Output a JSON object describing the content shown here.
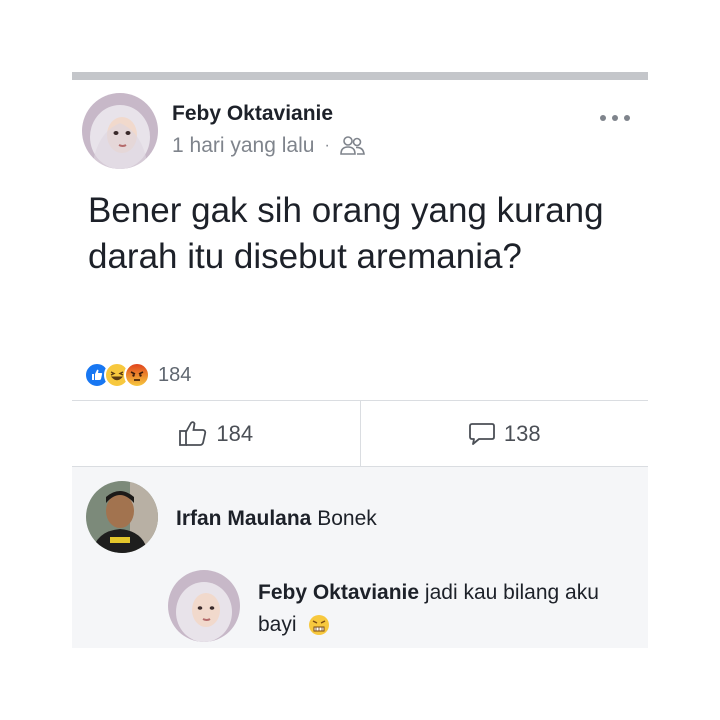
{
  "post": {
    "author": "Feby Oktavianie",
    "time": "1 hari yang lalu",
    "separator": "·",
    "text": "Bener gak sih orang yang kurang darah itu disebut aremania?",
    "reaction_count": "184",
    "reaction_icons": [
      "like-icon",
      "haha-icon",
      "angry-icon"
    ]
  },
  "actions": {
    "like_count": "184",
    "comment_count": "138"
  },
  "comments": [
    {
      "author": "Irfan Maulana",
      "text": "Bonek"
    },
    {
      "author": "Feby Oktavianie",
      "text": "jadi kau bilang aku bayi"
    }
  ],
  "colors": {
    "top_bar": "#c4c6ca",
    "like_blue": "#1877f2",
    "emoji_yellow": "#f7c83e",
    "angry_orange": "#e9710f",
    "secondary_text": "#7f848c",
    "comment_bg": "#f5f6f8"
  }
}
